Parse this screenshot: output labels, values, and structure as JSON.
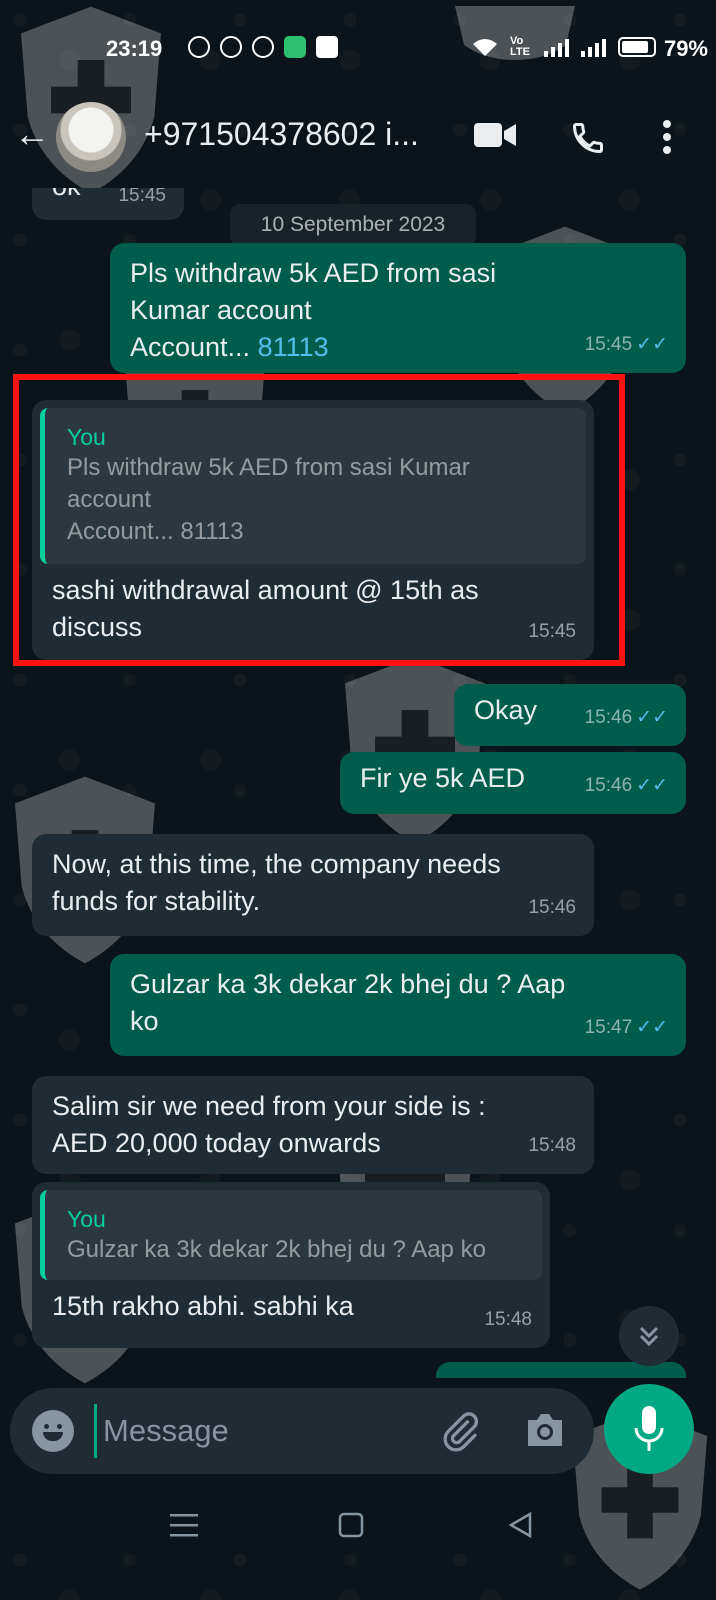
{
  "status_bar": {
    "time": "23:19",
    "network": "Vo LTE",
    "battery": "79%"
  },
  "header": {
    "contact": "+971504378602 i..."
  },
  "messages": [
    {
      "text": "ok",
      "time": "15:45"
    },
    {
      "date_chip": "10 September 2023"
    },
    {
      "line1": "Pls withdraw 5k AED from sasi",
      "line2": "Kumar account",
      "line3": "Account...",
      "link": "81113",
      "time": "15:45"
    },
    {
      "quote_author": "You",
      "quote_line1": "Pls withdraw 5k AED from sasi Kumar",
      "quote_line2": "account",
      "quote_line3": "Account... 81113",
      "line1": "sashi withdrawal amount @ 15th as",
      "line2": "discuss",
      "time": "15:45"
    },
    {
      "text": "Okay",
      "time": "15:46"
    },
    {
      "text": "Fir ye 5k AED",
      "time": "15:46"
    },
    {
      "line1": "Now, at this time, the company needs",
      "line2": "funds for stability.",
      "time": "15:46"
    },
    {
      "line1": "Gulzar ka 3k dekar 2k bhej du ? Aap",
      "line2": "ko",
      "time": "15:47"
    },
    {
      "line1": "Salim sir we need from your side is :",
      "line2": "AED 20,000 today onwards",
      "time": "15:48"
    },
    {
      "quote_author": "You",
      "quote_text": "Gulzar ka 3k dekar 2k bhej du ? Aap ko",
      "text": "15th rakho abhi. sabhi ka",
      "time": "15:48"
    }
  ],
  "input": {
    "placeholder": "Message"
  },
  "icons": [
    "back-arrow-icon",
    "video-call-icon",
    "phone-icon",
    "more-options-icon",
    "emoji-icon",
    "attach-icon",
    "camera-icon",
    "mic-icon",
    "scroll-down-icon",
    "double-check-icon"
  ],
  "colors": {
    "background": "#0b141a",
    "incoming": "#1f2c34",
    "outgoing": "#005c4b",
    "accent": "#00a884",
    "highlight_box": "#ff1212"
  }
}
